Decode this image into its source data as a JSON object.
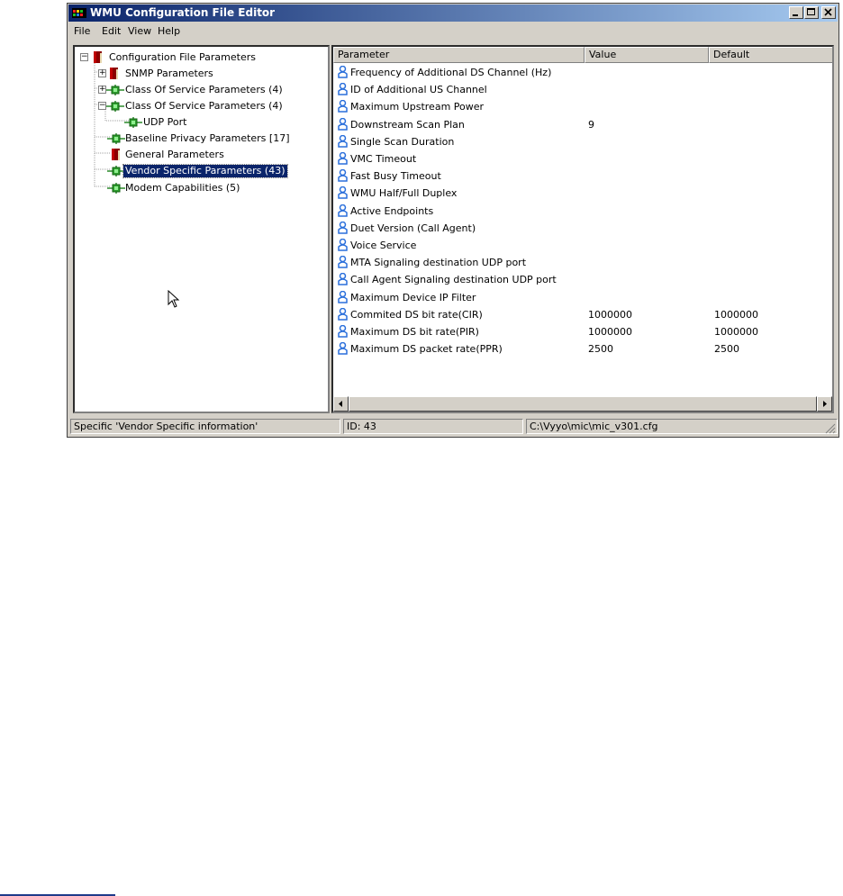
{
  "window": {
    "title": "WMU Configuration File Editor"
  },
  "menu": [
    "File",
    "Edit",
    "View",
    "Help"
  ],
  "tree": {
    "nodes": [
      {
        "label": "Configuration File Parameters",
        "icon": "book-icon",
        "expander": "−"
      },
      {
        "label": "SNMP Parameters",
        "icon": "book-icon",
        "expander": "+"
      },
      {
        "label": "Class Of Service Parameters (4)",
        "icon": "network-node-icon",
        "expander": "+"
      },
      {
        "label": "Class Of Service Parameters (4)",
        "icon": "network-node-icon",
        "expander": "−"
      },
      {
        "label": "UDP Port",
        "icon": "network-node-icon",
        "expander": ""
      },
      {
        "label": "Baseline Privacy Parameters [17]",
        "icon": "network-node-icon",
        "expander": ""
      },
      {
        "label": "General Parameters",
        "icon": "book-icon",
        "expander": ""
      },
      {
        "label": "Vendor Specific Parameters (43)",
        "icon": "network-node-icon",
        "expander": "",
        "selected": true
      },
      {
        "label": "Modem Capabilities (5)",
        "icon": "network-node-icon",
        "expander": ""
      }
    ]
  },
  "table": {
    "columns": [
      "Parameter",
      "Value",
      "Default"
    ],
    "rows": [
      [
        "Frequency of Additional DS Channel (Hz)",
        "",
        ""
      ],
      [
        "ID of Additional US Channel",
        "",
        ""
      ],
      [
        "Maximum Upstream Power",
        "",
        ""
      ],
      [
        "Downstream Scan Plan",
        "9",
        ""
      ],
      [
        "Single Scan Duration",
        "",
        ""
      ],
      [
        "VMC Timeout",
        "",
        ""
      ],
      [
        "Fast Busy Timeout",
        "",
        ""
      ],
      [
        "WMU  Half/Full Duplex",
        "",
        ""
      ],
      [
        "Active Endpoints",
        "",
        ""
      ],
      [
        "Duet Version (Call Agent)",
        "",
        ""
      ],
      [
        "Voice Service",
        "",
        ""
      ],
      [
        "MTA Signaling destination UDP port",
        "",
        ""
      ],
      [
        "Call Agent Signaling destination UDP port",
        "",
        ""
      ],
      [
        "Maximum Device IP Filter",
        "",
        ""
      ],
      [
        "Commited DS bit rate(CIR)",
        "1000000",
        "1000000"
      ],
      [
        "Maximum DS bit rate(PIR)",
        "1000000",
        "1000000"
      ],
      [
        "Maximum DS packet rate(PPR)",
        "2500",
        "2500"
      ]
    ]
  },
  "status": {
    "description": "Specific 'Vendor Specific information'",
    "id": "ID: 43",
    "path": "C:\\Vyyo\\mic\\mic_v301.cfg"
  },
  "colors": {
    "title_gradient_start": "#0a246a",
    "title_gradient_end": "#a6caf0",
    "selection": "#0a246a",
    "user_icon": "#2a6fdb"
  }
}
